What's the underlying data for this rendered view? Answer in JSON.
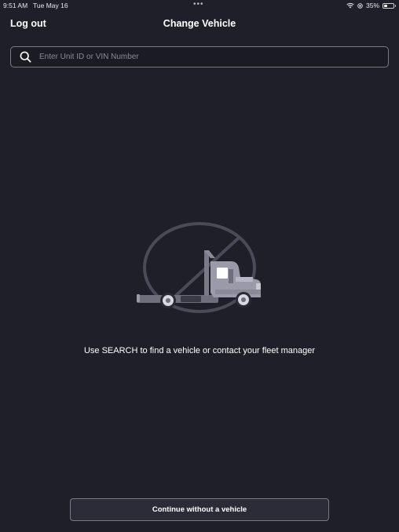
{
  "status_bar": {
    "time": "9:51 AM",
    "date": "Tue May 16",
    "multitask_dots": "•••",
    "battery_percent": "35%",
    "battery_level": 0.35,
    "icons": [
      "wifi-icon",
      "location-icon",
      "battery-icon"
    ]
  },
  "nav": {
    "logout_label": "Log out",
    "title": "Change Vehicle"
  },
  "search": {
    "placeholder": "Enter Unit ID or VIN Number",
    "value": "",
    "icon": "search-icon"
  },
  "empty_state": {
    "icon": "no-vehicle-truck-icon",
    "message": "Use SEARCH to find a vehicle or contact your fleet manager"
  },
  "actions": {
    "continue_label": "Continue without a vehicle"
  },
  "colors": {
    "background": "#1f1f29",
    "border": "#7a7a86",
    "button_bg": "#2c2c38",
    "placeholder": "#8b8b96",
    "illustration_gray": "#4a4a58",
    "truck_body": "#9a9aa8"
  }
}
